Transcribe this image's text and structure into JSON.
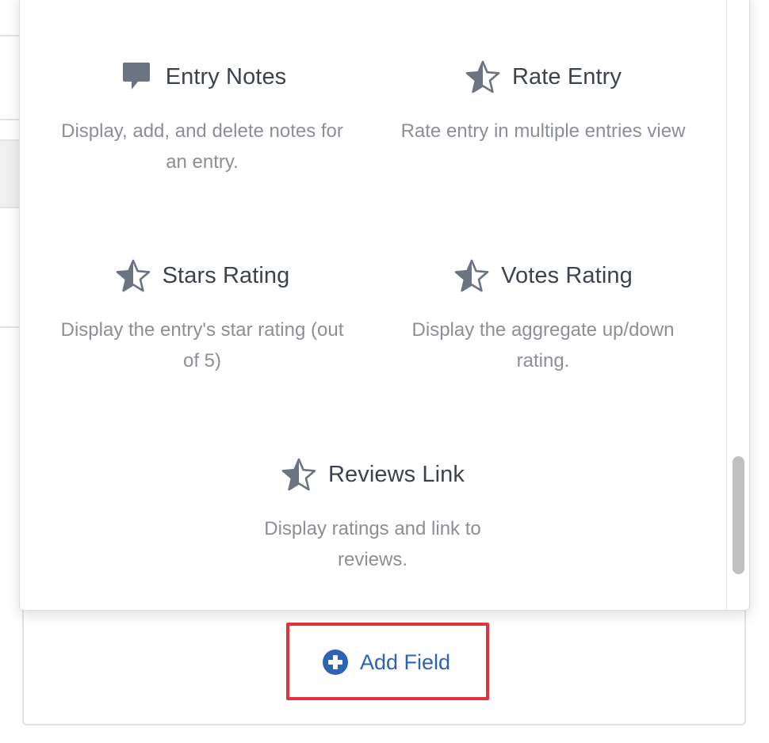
{
  "fields": [
    {
      "title": "Entry Notes",
      "description": "Display, add, and delete notes for an entry.",
      "icon": "speech-bubble-icon"
    },
    {
      "title": "Rate Entry",
      "description": "Rate entry in multiple entries view",
      "icon": "star-half-icon"
    },
    {
      "title": "Stars Rating",
      "description": "Display the entry's star rating (out of 5)",
      "icon": "star-half-icon"
    },
    {
      "title": "Votes Rating",
      "description": "Display the aggregate up/down rating.",
      "icon": "star-half-icon"
    },
    {
      "title": "Reviews Link",
      "description": "Display ratings and link to reviews.",
      "icon": "star-half-icon"
    }
  ],
  "add_field": {
    "label": "Add Field",
    "icon": "plus-circle-icon"
  },
  "colors": {
    "icon": "#6b7480",
    "title": "#3c434a",
    "description": "#8c8f94",
    "link": "#2c63b2",
    "highlight": "#e0323d"
  }
}
